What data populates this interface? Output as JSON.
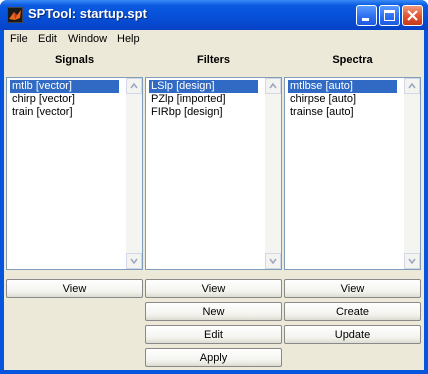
{
  "window": {
    "title": "SPTool: startup.spt"
  },
  "menu": [
    "File",
    "Edit",
    "Window",
    "Help"
  ],
  "columns": {
    "signals": {
      "heading": "Signals",
      "items": [
        "mtlb [vector]",
        "chirp [vector]",
        "train [vector]"
      ],
      "selected_index": 0,
      "buttons": [
        "View"
      ]
    },
    "filters": {
      "heading": "Filters",
      "items": [
        "LSlp [design]",
        "PZlp [imported]",
        "FIRbp [design]"
      ],
      "selected_index": 0,
      "buttons": [
        "View",
        "New",
        "Edit",
        "Apply"
      ]
    },
    "spectra": {
      "heading": "Spectra",
      "items": [
        "mtlbse [auto]",
        "chirpse [auto]",
        "trainse [auto]"
      ],
      "selected_index": 0,
      "buttons": [
        "View",
        "Create",
        "Update"
      ]
    }
  },
  "colors": {
    "titlebar": "#0650d8",
    "face": "#ece9d8",
    "selection": "#316ac5",
    "close_button": "#e0532f"
  },
  "icons": [
    "matlab-logo-icon",
    "minimize-icon",
    "maximize-icon",
    "close-icon",
    "scroll-up-icon",
    "scroll-down-icon"
  ]
}
